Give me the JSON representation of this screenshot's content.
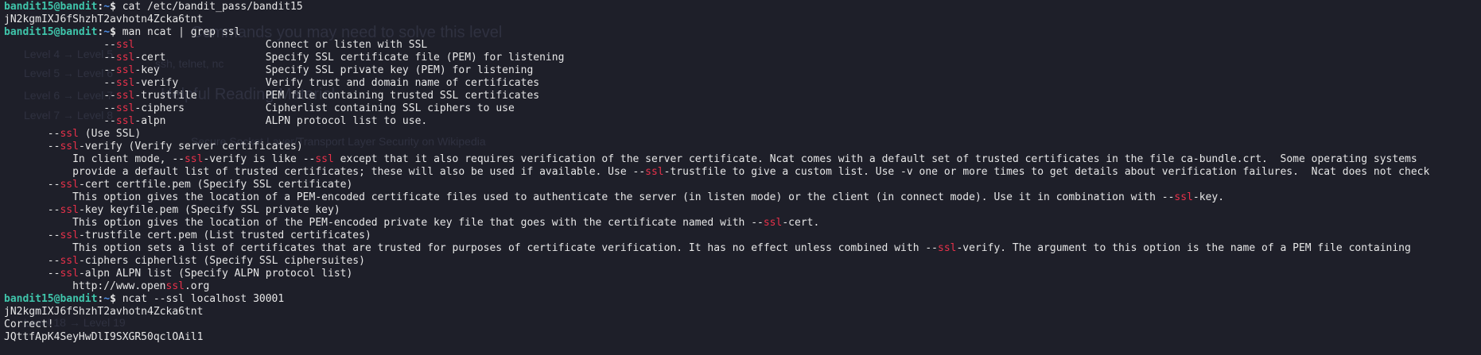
{
  "colors": {
    "background": "#1e1f29",
    "text": "#e6e6e6",
    "prompt_user": "#3fc5ab",
    "prompt_path": "#4f8fe6",
    "grep_highlight": "#e8314a",
    "ghost_text": "#2f3140"
  },
  "prompt": {
    "user_host": "bandit15@bandit",
    "separator": ":",
    "path": "~",
    "symbol": "$ "
  },
  "lines": [
    {
      "type": "prompt",
      "command": "cat /etc/bandit_pass/bandit15"
    },
    {
      "type": "output",
      "segments": [
        {
          "t": "jN2kgmIXJ6fShzhT2avhotn4Zcka6tnt"
        }
      ]
    },
    {
      "type": "prompt",
      "command": "man ncat | grep ssl"
    },
    {
      "type": "output",
      "segments": [
        {
          "t": "                --"
        },
        {
          "t": "ssl",
          "hl": true
        },
        {
          "t": "                     Connect or listen with SSL"
        }
      ]
    },
    {
      "type": "output",
      "segments": [
        {
          "t": "                --"
        },
        {
          "t": "ssl",
          "hl": true
        },
        {
          "t": "-cert                Specify SSL certificate file (PEM) for listening"
        }
      ]
    },
    {
      "type": "output",
      "segments": [
        {
          "t": "                --"
        },
        {
          "t": "ssl",
          "hl": true
        },
        {
          "t": "-key                 Specify SSL private key (PEM) for listening"
        }
      ]
    },
    {
      "type": "output",
      "segments": [
        {
          "t": "                --"
        },
        {
          "t": "ssl",
          "hl": true
        },
        {
          "t": "-verify              Verify trust and domain name of certificates"
        }
      ]
    },
    {
      "type": "output",
      "segments": [
        {
          "t": "                --"
        },
        {
          "t": "ssl",
          "hl": true
        },
        {
          "t": "-trustfile           PEM file containing trusted SSL certificates"
        }
      ]
    },
    {
      "type": "output",
      "segments": [
        {
          "t": "                --"
        },
        {
          "t": "ssl",
          "hl": true
        },
        {
          "t": "-ciphers             Cipherlist containing SSL ciphers to use"
        }
      ]
    },
    {
      "type": "output",
      "segments": [
        {
          "t": "                --"
        },
        {
          "t": "ssl",
          "hl": true
        },
        {
          "t": "-alpn                ALPN protocol list to use."
        }
      ]
    },
    {
      "type": "output",
      "segments": [
        {
          "t": "       --"
        },
        {
          "t": "ssl",
          "hl": true
        },
        {
          "t": " (Use SSL)"
        }
      ]
    },
    {
      "type": "output",
      "segments": [
        {
          "t": "       --"
        },
        {
          "t": "ssl",
          "hl": true
        },
        {
          "t": "-verify (Verify server certificates)"
        }
      ]
    },
    {
      "type": "output",
      "segments": [
        {
          "t": "           In client mode, --"
        },
        {
          "t": "ssl",
          "hl": true
        },
        {
          "t": "-verify is like --"
        },
        {
          "t": "ssl",
          "hl": true
        },
        {
          "t": " except that it also requires verification of the server certificate. Ncat comes with a default set of trusted certificates in the file ca-bundle.crt.  Some operating systems"
        }
      ]
    },
    {
      "type": "output",
      "segments": [
        {
          "t": "           provide a default list of trusted certificates; these will also be used if available. Use --"
        },
        {
          "t": "ssl",
          "hl": true
        },
        {
          "t": "-trustfile to give a custom list. Use -v one or more times to get details about verification failures.  Ncat does not check"
        }
      ]
    },
    {
      "type": "output",
      "segments": [
        {
          "t": "       --"
        },
        {
          "t": "ssl",
          "hl": true
        },
        {
          "t": "-cert certfile.pem (Specify SSL certificate)"
        }
      ]
    },
    {
      "type": "output",
      "segments": [
        {
          "t": "           This option gives the location of a PEM-encoded certificate files used to authenticate the server (in listen mode) or the client (in connect mode). Use it in combination with --"
        },
        {
          "t": "ssl",
          "hl": true
        },
        {
          "t": "-key."
        }
      ]
    },
    {
      "type": "output",
      "segments": [
        {
          "t": "       --"
        },
        {
          "t": "ssl",
          "hl": true
        },
        {
          "t": "-key keyfile.pem (Specify SSL private key)"
        }
      ]
    },
    {
      "type": "output",
      "segments": [
        {
          "t": "           This option gives the location of the PEM-encoded private key file that goes with the certificate named with --"
        },
        {
          "t": "ssl",
          "hl": true
        },
        {
          "t": "-cert."
        }
      ]
    },
    {
      "type": "output",
      "segments": [
        {
          "t": "       --"
        },
        {
          "t": "ssl",
          "hl": true
        },
        {
          "t": "-trustfile cert.pem (List trusted certificates)"
        }
      ]
    },
    {
      "type": "output",
      "segments": [
        {
          "t": "           This option sets a list of certificates that are trusted for purposes of certificate verification. It has no effect unless combined with --"
        },
        {
          "t": "ssl",
          "hl": true
        },
        {
          "t": "-verify. The argument to this option is the name of a PEM file containing"
        }
      ]
    },
    {
      "type": "output",
      "segments": [
        {
          "t": "       --"
        },
        {
          "t": "ssl",
          "hl": true
        },
        {
          "t": "-ciphers cipherlist (Specify SSL ciphersuites)"
        }
      ]
    },
    {
      "type": "output",
      "segments": [
        {
          "t": "       --"
        },
        {
          "t": "ssl",
          "hl": true
        },
        {
          "t": "-alpn ALPN list (Specify ALPN protocol list)"
        }
      ]
    },
    {
      "type": "output",
      "segments": [
        {
          "t": "           http://www.open"
        },
        {
          "t": "ssl",
          "hl": true
        },
        {
          "t": ".org"
        }
      ]
    },
    {
      "type": "prompt",
      "command": "ncat --ssl localhost 30001"
    },
    {
      "type": "output",
      "segments": [
        {
          "t": "jN2kgmIXJ6fShzhT2avhotn4Zcka6tnt"
        }
      ]
    },
    {
      "type": "output",
      "segments": [
        {
          "t": "Correct!"
        }
      ]
    },
    {
      "type": "output",
      "segments": [
        {
          "t": "JQttfApK4SeyHwDlI9SXGR50qclOAil1"
        }
      ]
    }
  ],
  "background_ghost": [
    {
      "text": "Commands you may need to solve this level",
      "name": "ghost-heading-commands"
    },
    {
      "text": "ssh, telnet, nc",
      "name": "ghost-commands-list"
    },
    {
      "text": "Helpful Reading Material",
      "name": "ghost-heading-reading"
    },
    {
      "text": "Secure Socket Layer/Transport Layer Security on Wikipedia",
      "name": "ghost-reading-link"
    },
    {
      "text": "Level 4 → Level 5",
      "name": "ghost-nav-item"
    },
    {
      "text": "Level 5 → Level 6",
      "name": "ghost-nav-item"
    },
    {
      "text": "Level 6 → Level 7",
      "name": "ghost-nav-item"
    },
    {
      "text": "Level 7 → Level 8",
      "name": "ghost-nav-item"
    },
    {
      "text": "Level 18 → Level 19",
      "name": "ghost-nav-item"
    }
  ]
}
